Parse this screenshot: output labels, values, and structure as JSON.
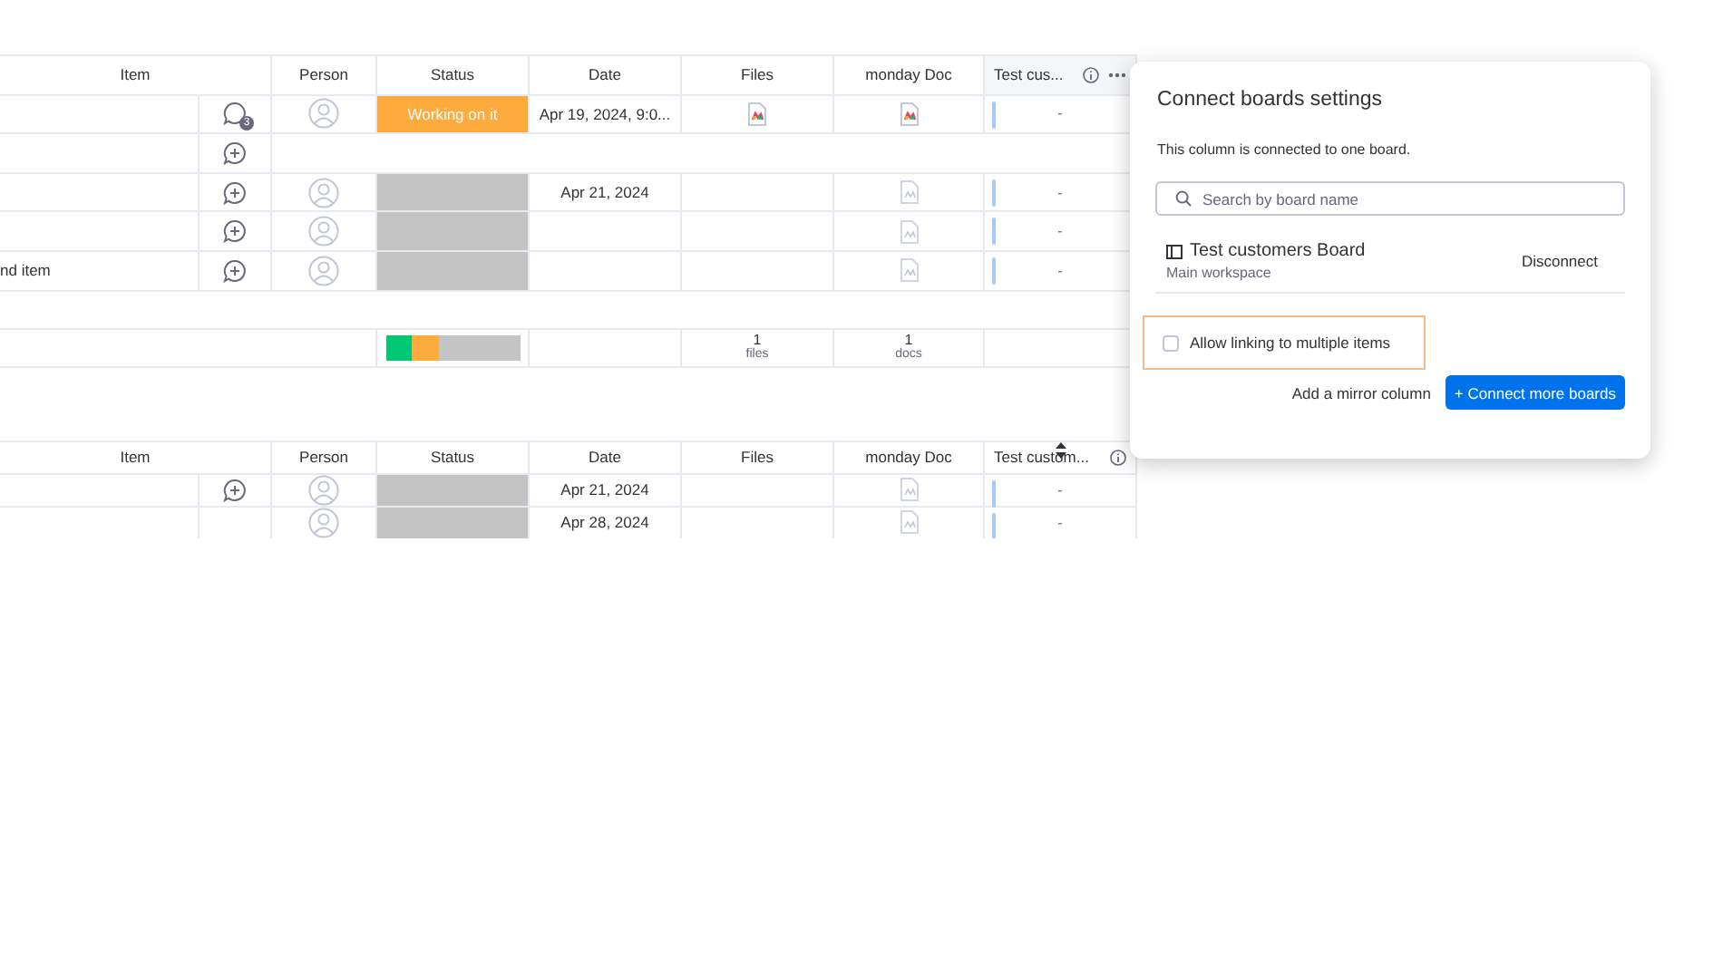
{
  "groups": [
    {
      "columns": [
        {
          "label": "Item"
        },
        {
          "label": "Person"
        },
        {
          "label": "Status"
        },
        {
          "label": "Date"
        },
        {
          "label": "Files"
        },
        {
          "label": "monday Doc"
        },
        {
          "label": "Test cus...",
          "icons": [
            {
              "kind": "info"
            },
            {
              "kind": "more"
            }
          ]
        }
      ],
      "rows": [
        {
          "update": {
            "kind": "comments",
            "badge": "3"
          },
          "person": {
            "kind": "avatar"
          },
          "status": {
            "label": "Working on it",
            "color": "#fdab3d"
          },
          "date": "Apr 19, 2024, 9:0...",
          "file": {
            "kind": "file"
          },
          "doc": {
            "kind": "colored"
          },
          "link": "-"
        },
        {
          "update": {
            "kind": "add"
          }
        },
        {
          "update": {
            "kind": "add"
          },
          "person": {
            "kind": "avatar"
          },
          "status": {
            "color": "#c4c4c4"
          },
          "date": "Apr 21, 2024",
          "doc": {
            "kind": "blank"
          },
          "link": "-"
        },
        {
          "update": {
            "kind": "add"
          },
          "person": {
            "kind": "avatar"
          },
          "status": {
            "color": "#c4c4c4"
          },
          "doc": {
            "kind": "blank"
          },
          "link": "-"
        },
        {
          "item": "nd item",
          "update": {
            "kind": "add"
          },
          "person": {
            "kind": "avatar"
          },
          "status": {
            "color": "#c4c4c4"
          },
          "doc": {
            "kind": "blank"
          },
          "link": "-"
        }
      ],
      "summary": {
        "status_segments": [
          {
            "color": "#00c875",
            "level": 0.2
          },
          {
            "color": "#fdab3d",
            "level": 0.2
          },
          {
            "color": "#c4c4c4",
            "level": 0.6
          }
        ],
        "files": {
          "count": "1",
          "unit": "files"
        },
        "docs": {
          "count": "1",
          "unit": "docs"
        }
      }
    },
    {
      "columns": [
        {
          "label": "Item"
        },
        {
          "label": "Person"
        },
        {
          "label": "Status"
        },
        {
          "label": "Date"
        },
        {
          "label": "Files"
        },
        {
          "label": "monday Doc"
        },
        {
          "label": "Test custom...",
          "icons": [
            {
              "kind": "info"
            },
            {
              "kind": "sort"
            }
          ]
        }
      ],
      "rows": [
        {
          "update": {
            "kind": "add"
          },
          "person": {
            "kind": "avatar"
          },
          "status": {
            "color": "#c4c4c4"
          },
          "date": "Apr 21, 2024",
          "doc": {
            "kind": "blank"
          },
          "link": "-"
        },
        {
          "person": {
            "kind": "avatar"
          },
          "status": {
            "color": "#c4c4c4"
          },
          "date": "Apr 28, 2024",
          "doc": {
            "kind": "blank"
          },
          "link": "-"
        }
      ]
    }
  ],
  "popup": {
    "title": "Connect boards settings",
    "description": "This column is connected to one board.",
    "search": {
      "placeholder": "Search by board name"
    },
    "boards": [
      {
        "name": "Test customers Board",
        "workspace": "Main workspace",
        "action": "Disconnect"
      }
    ],
    "option": {
      "label": "Allow linking to multiple items",
      "checked": false,
      "highlighted": true
    },
    "secondary_action": "Add a mirror column",
    "primary_action": "+ Connect more boards"
  }
}
